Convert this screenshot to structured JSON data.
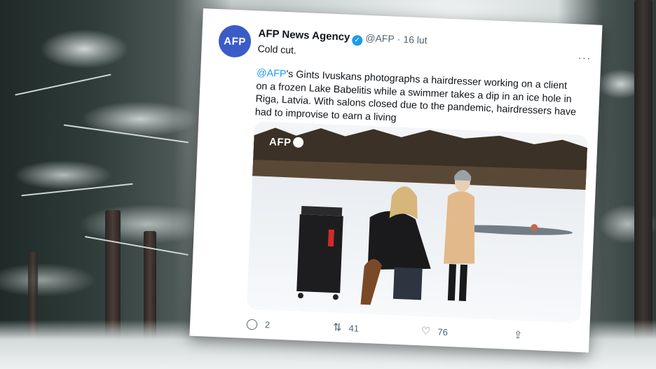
{
  "tweet": {
    "avatar_text": "AFP",
    "display_name": "AFP News Agency",
    "verified_icon": "verified-badge-icon",
    "handle": "@AFP",
    "separator": "·",
    "date": "16 lut",
    "short_text": "Cold cut.",
    "more_icon": "···",
    "body_mention": "@AFP",
    "body_text": "'s Gints Ivuskans photographs a hairdresser working on a client on a frozen Lake Babelitis while a swimmer takes a dip in an ice hole in Riga, Latvia. With salons closed due to the pandemic, hairdressers have had to improvise to earn a living",
    "photo_watermark": "AFP",
    "actions": {
      "reply": {
        "icon": "reply-icon",
        "glyph": "◯",
        "count": "2"
      },
      "retweet": {
        "icon": "retweet-icon",
        "glyph": "⇅",
        "count": "41"
      },
      "like": {
        "icon": "heart-icon",
        "glyph": "♡",
        "count": "76"
      },
      "share": {
        "icon": "share-icon",
        "glyph": "⇪"
      }
    }
  },
  "colors": {
    "link": "#1d9bf0",
    "text": "#0f1419",
    "muted": "#536471",
    "avatar_bg": "#3b5bc7"
  }
}
